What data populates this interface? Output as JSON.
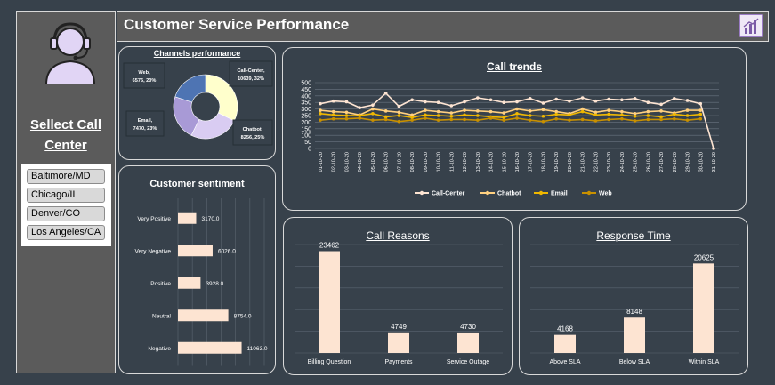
{
  "sidebar": {
    "title_line1": "Sellect Call",
    "title_line2": "Center",
    "slicer_items": [
      "Baltimore/MD",
      "Chicago/IL",
      "Denver/CO",
      "Los Angeles/CA"
    ]
  },
  "header": {
    "title": "Customer Service Performance",
    "icon": "bar-chart-icon"
  },
  "colors": {
    "background": "#37414b",
    "bar_fill": "#fde4d2",
    "donut": [
      "#ffffcc",
      "#d9ccf2",
      "#a89ad6",
      "#4e74b3"
    ],
    "line_series": [
      "#fde4d2",
      "#ffd080",
      "#f0b800",
      "#c89000"
    ]
  },
  "chart_data": [
    {
      "id": "channels",
      "type": "pie",
      "title": "Channels performance",
      "slices": [
        {
          "label": "Call-Center",
          "value": 10639,
          "percent": "32%"
        },
        {
          "label": "Chatbot",
          "value": 8256,
          "percent": "25%"
        },
        {
          "label": "Email",
          "value": 7470,
          "percent": "23%"
        },
        {
          "label": "Web",
          "value": 6576,
          "percent": "20%"
        }
      ],
      "data_labels": [
        "Call-Center, 10639, 32%",
        "Chatbot, 8256, 25%",
        "Email, 7470, 23%",
        "Web, 6576, 20%"
      ]
    },
    {
      "id": "sentiment",
      "type": "bar",
      "title": "Customer sentiment",
      "orientation": "horizontal",
      "categories": [
        "Very Positive",
        "Very Negative",
        "Positive",
        "Neutral",
        "Negative"
      ],
      "values": [
        3170,
        6026,
        3928,
        8754,
        11063
      ],
      "value_labels": [
        "3170.0",
        "6026.0",
        "3928.0",
        "8754.0",
        "11063.0"
      ],
      "xlim": [
        0,
        15000
      ]
    },
    {
      "id": "trends",
      "type": "line",
      "title": "Call trends",
      "x": [
        "01-10-20",
        "02-10-20",
        "03-10-20",
        "04-10-20",
        "05-10-20",
        "06-10-20",
        "07-10-20",
        "08-10-20",
        "09-10-20",
        "10-10-20",
        "11-10-20",
        "12-10-20",
        "13-10-20",
        "14-10-20",
        "15-10-20",
        "16-10-20",
        "17-10-20",
        "18-10-20",
        "19-10-20",
        "20-10-20",
        "21-10-20",
        "22-10-20",
        "23-10-20",
        "24-10-20",
        "25-10-20",
        "26-10-20",
        "27-10-20",
        "28-10-20",
        "29-10-20",
        "30-10-20",
        "31-10-20"
      ],
      "yticks": [
        "0",
        "50",
        "100",
        "150",
        "200",
        "250",
        "300",
        "350",
        "400",
        "450",
        "500"
      ],
      "ylim": [
        0,
        500
      ],
      "series": [
        {
          "name": "Call-Center",
          "values": [
            340,
            360,
            355,
            310,
            330,
            420,
            320,
            370,
            355,
            350,
            325,
            355,
            385,
            370,
            350,
            355,
            380,
            345,
            375,
            360,
            385,
            360,
            375,
            370,
            380,
            350,
            335,
            380,
            365,
            340,
            0
          ]
        },
        {
          "name": "Chatbot",
          "values": [
            290,
            280,
            275,
            255,
            300,
            285,
            275,
            255,
            290,
            280,
            270,
            290,
            285,
            280,
            270,
            300,
            285,
            295,
            280,
            265,
            300,
            275,
            290,
            280,
            265,
            280,
            285,
            270,
            290,
            290,
            null
          ]
        },
        {
          "name": "Email",
          "values": [
            265,
            255,
            250,
            250,
            265,
            240,
            250,
            235,
            255,
            250,
            245,
            255,
            250,
            240,
            235,
            265,
            250,
            245,
            260,
            255,
            280,
            255,
            260,
            255,
            245,
            250,
            240,
            260,
            250,
            260,
            null
          ]
        },
        {
          "name": "Web",
          "values": [
            215,
            225,
            225,
            230,
            215,
            220,
            205,
            215,
            230,
            215,
            220,
            220,
            215,
            230,
            215,
            230,
            215,
            205,
            225,
            215,
            220,
            210,
            220,
            225,
            210,
            220,
            220,
            225,
            215,
            225,
            null
          ]
        }
      ]
    },
    {
      "id": "reasons",
      "type": "bar",
      "title": "Call Reasons",
      "categories": [
        "Billing Question",
        "Payments",
        "Service Outage"
      ],
      "values": [
        23462,
        4749,
        4730
      ],
      "value_labels": [
        "23462",
        "4749",
        "4730"
      ],
      "ylim": [
        0,
        25000
      ]
    },
    {
      "id": "response",
      "type": "bar",
      "title": "Response Time",
      "categories": [
        "Above SLA",
        "Below SLA",
        "Within SLA"
      ],
      "values": [
        4168,
        8148,
        20625
      ],
      "value_labels": [
        "4168",
        "8148",
        "20625"
      ],
      "ylim": [
        0,
        25000
      ]
    }
  ]
}
